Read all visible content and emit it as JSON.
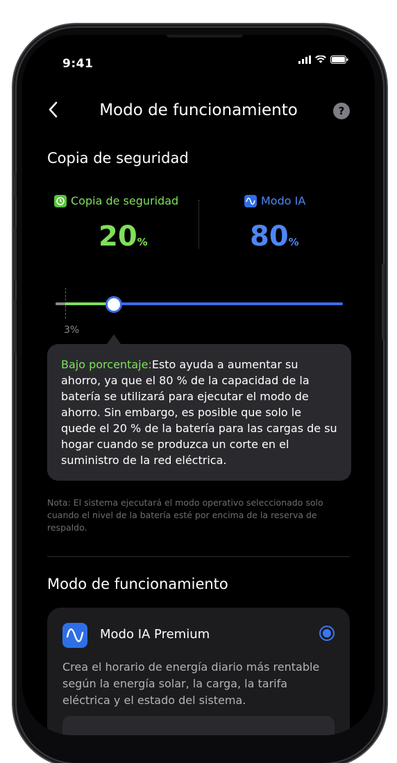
{
  "status": {
    "time": "9:41"
  },
  "nav": {
    "title": "Modo de funcionamiento",
    "help": "?"
  },
  "backup": {
    "section_title": "Copia de seguridad",
    "backup_label": "Copia de seguridad",
    "backup_value": "20",
    "ai_label": "Modo IA",
    "ai_value": "80",
    "percent_sign": "%",
    "slider_min_label": "3%",
    "slider_value_percent": 20
  },
  "tooltip": {
    "highlight": "Bajo porcentaje:",
    "text": "Esto ayuda a aumentar su ahorro, ya que el 80 % de la capacidad de la batería se utilizará para ejecutar el modo de ahorro. Sin embargo, es posible que solo le quede el 20 % de la batería para las cargas de su hogar cuando se produzca un corte en el suministro de la red eléctrica."
  },
  "note": "Nota: El sistema ejecutará el modo operativo seleccionado solo cuando el nivel de la batería esté por encima de la reserva de respaldo.",
  "mode_section": {
    "title": "Modo de funcionamiento",
    "card_title": "Modo IA Premium",
    "card_description": "Crea el horario de energía diario más rentable según la energía solar, la carga, la tarifa eléctrica y el estado del sistema.",
    "selected": true
  },
  "colors": {
    "green": "#7fe05c",
    "blue": "#4d86f5"
  },
  "icons": [
    "back-icon",
    "help-icon",
    "signal-icon",
    "wifi-icon",
    "battery-icon",
    "backup-icon",
    "ai-mode-icon",
    "ai-premium-icon"
  ]
}
